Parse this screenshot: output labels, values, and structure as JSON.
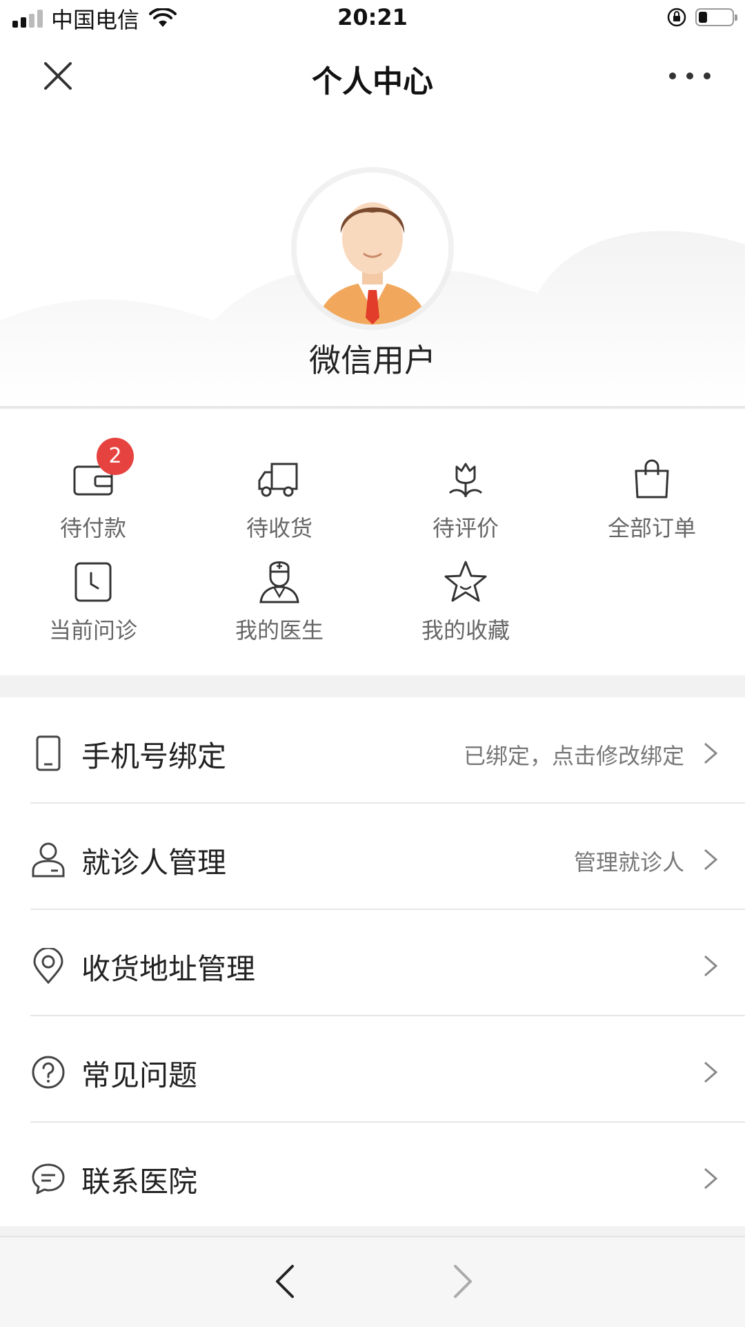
{
  "status_bar": {
    "carrier": "中国电信",
    "time": "20:21",
    "battery_level": 0.25
  },
  "nav": {
    "title": "个人中心",
    "close_icon": "close-icon",
    "more_icon": "more-dots-icon"
  },
  "profile": {
    "username": "微信用户",
    "avatar_icon": "doctor-avatar"
  },
  "orders": [
    {
      "label": "待付款",
      "icon": "wallet-icon",
      "badge": "2"
    },
    {
      "label": "待收货",
      "icon": "truck-icon"
    },
    {
      "label": "待评价",
      "icon": "flower-icon"
    },
    {
      "label": "全部订单",
      "icon": "shopping-bag-icon"
    },
    {
      "label": "当前问诊",
      "icon": "clock-icon"
    },
    {
      "label": "我的医生",
      "icon": "doctor-icon"
    },
    {
      "label": "我的收藏",
      "icon": "star-icon"
    }
  ],
  "menu": [
    {
      "title": "手机号绑定",
      "sub": "已绑定，点击修改绑定",
      "icon": "phone-icon"
    },
    {
      "title": "就诊人管理",
      "sub": "管理就诊人",
      "icon": "person-icon"
    },
    {
      "title": "收货地址管理",
      "sub": "",
      "icon": "location-pin-icon"
    },
    {
      "title": "常见问题",
      "sub": "",
      "icon": "question-icon"
    },
    {
      "title": "联系医院",
      "sub": "",
      "icon": "chat-bubble-icon"
    }
  ],
  "bottom_nav": {
    "back_icon": "chevron-left-icon",
    "forward_icon": "chevron-right-icon"
  },
  "colors": {
    "badge": "#e64340",
    "background": "#f2f2f2",
    "text_primary": "#222222",
    "text_secondary": "#777777"
  }
}
